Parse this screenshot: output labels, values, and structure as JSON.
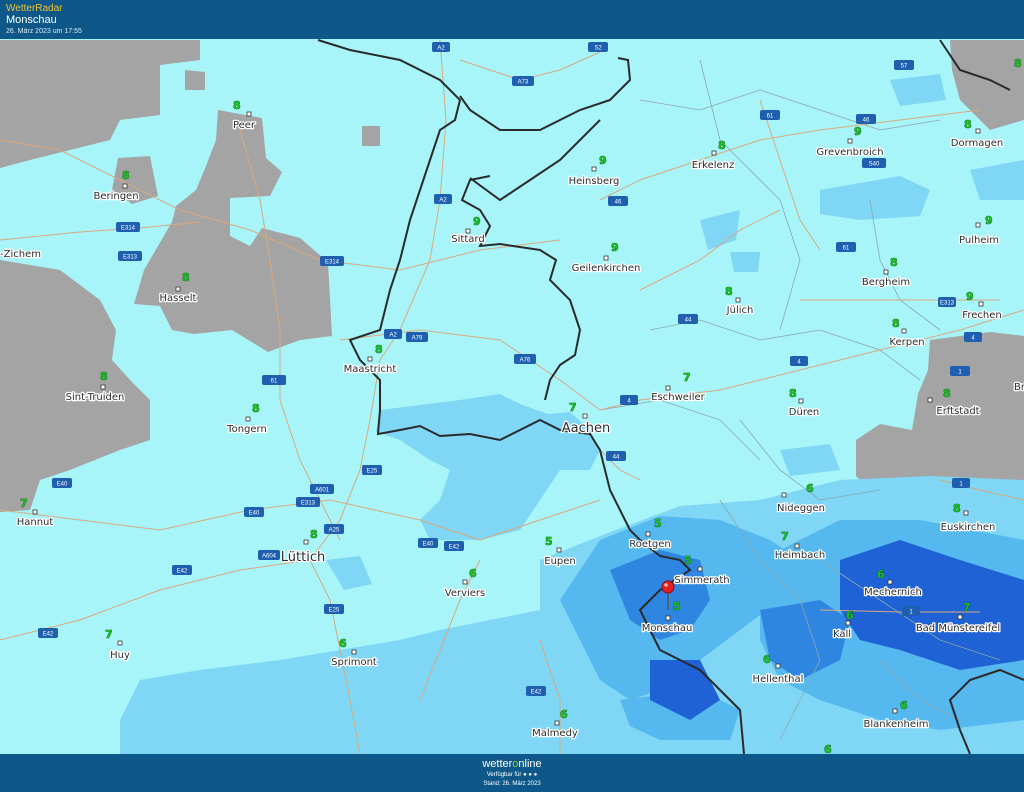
{
  "header": {
    "brand": "WetterRadar",
    "location": "Monschau",
    "timestamp": "26. März 2023 um 17:55"
  },
  "footer": {
    "logo_prefix": "wetter",
    "logo_o": "o",
    "logo_suffix": "nline",
    "availability": "Verfügbar für ",
    "stand": "Stand: 26. März 2023"
  },
  "colors": {
    "header_bg": "#0d5888",
    "map_bg": "#a8f5f9",
    "rain_light": "#7fd6f5",
    "rain_medium": "#55b8ee",
    "rain_heavy": "#2f86e0",
    "rain_very_heavy": "#1e62d6",
    "cloud_gray": "#a4a4a4",
    "border_line": "#2a2a2a",
    "road_line": "#d8a97e",
    "road_badge": "#1e5fb0",
    "number_green": "#17c21f",
    "brand_accent": "#f2c230",
    "pin_red": "#e22222"
  },
  "marker": {
    "icon": "map-pin-icon",
    "city": "Monschau"
  },
  "cities": [
    {
      "name": "Peer",
      "value": "8"
    },
    {
      "name": "Beringen",
      "value": "8"
    },
    {
      "name": "Hasselt",
      "value": "8"
    },
    {
      "name": "Sint-Truiden",
      "value": "8"
    },
    {
      "name": "Tongern",
      "value": "8"
    },
    {
      "name": "Hannut",
      "value": "7"
    },
    {
      "name": "Lüttich",
      "value": "8"
    },
    {
      "name": "Huy",
      "value": "7"
    },
    {
      "name": "Sprimont",
      "value": "6"
    },
    {
      "name": "Verviers",
      "value": "6"
    },
    {
      "name": "Malmedy",
      "value": "6"
    },
    {
      "name": "Maastricht",
      "value": "8"
    },
    {
      "name": "Sittard",
      "value": "9"
    },
    {
      "name": "Heinsberg",
      "value": "9"
    },
    {
      "name": "Geilenkirchen",
      "value": "9"
    },
    {
      "name": "Erkelenz",
      "value": "8"
    },
    {
      "name": "Grevenbroich",
      "value": "9"
    },
    {
      "name": "Dormagen",
      "value": "8"
    },
    {
      "name": "Pulheim",
      "value": "9"
    },
    {
      "name": "Bergheim",
      "value": "8"
    },
    {
      "name": "Jülich",
      "value": "8"
    },
    {
      "name": "Frechen",
      "value": "9"
    },
    {
      "name": "Kerpen",
      "value": "8"
    },
    {
      "name": "Eschweiler",
      "value": "7"
    },
    {
      "name": "Aachen",
      "value": "7"
    },
    {
      "name": "Düren",
      "value": "8"
    },
    {
      "name": "Erftstadt",
      "value": "8"
    },
    {
      "name": "Eupen",
      "value": "5"
    },
    {
      "name": "Roetgen",
      "value": "5"
    },
    {
      "name": "Simmerath",
      "value": "5"
    },
    {
      "name": "Monschau",
      "value": "5"
    },
    {
      "name": "Nideggen",
      "value": "6"
    },
    {
      "name": "Heimbach",
      "value": "7"
    },
    {
      "name": "Euskirchen",
      "value": "8"
    },
    {
      "name": "Mechernich",
      "value": "6"
    },
    {
      "name": "Kall",
      "value": "6"
    },
    {
      "name": "Bad Münstereifel",
      "value": "7"
    },
    {
      "name": "Hellenthal",
      "value": "6"
    },
    {
      "name": "Blankenheim",
      "value": "6"
    }
  ],
  "edge_labels": {
    "zichem": "-Zichem",
    "br": "Br",
    "bottom_value": "6",
    "top_value": "8"
  },
  "roads": [
    "A2",
    "A73",
    "S2",
    "57",
    "61",
    "46",
    "S40",
    "E314",
    "E313",
    "A2",
    "46",
    "E314",
    "A2",
    "A79",
    "A76",
    "61",
    "44",
    "4",
    "4",
    "1",
    "61",
    "E313",
    "4",
    "44",
    "E25",
    "E40",
    "A601",
    "E313",
    "A25",
    "E40",
    "E40",
    "E42",
    "A604",
    "E42",
    "E25",
    "E42",
    "E42",
    "1",
    "1"
  ]
}
